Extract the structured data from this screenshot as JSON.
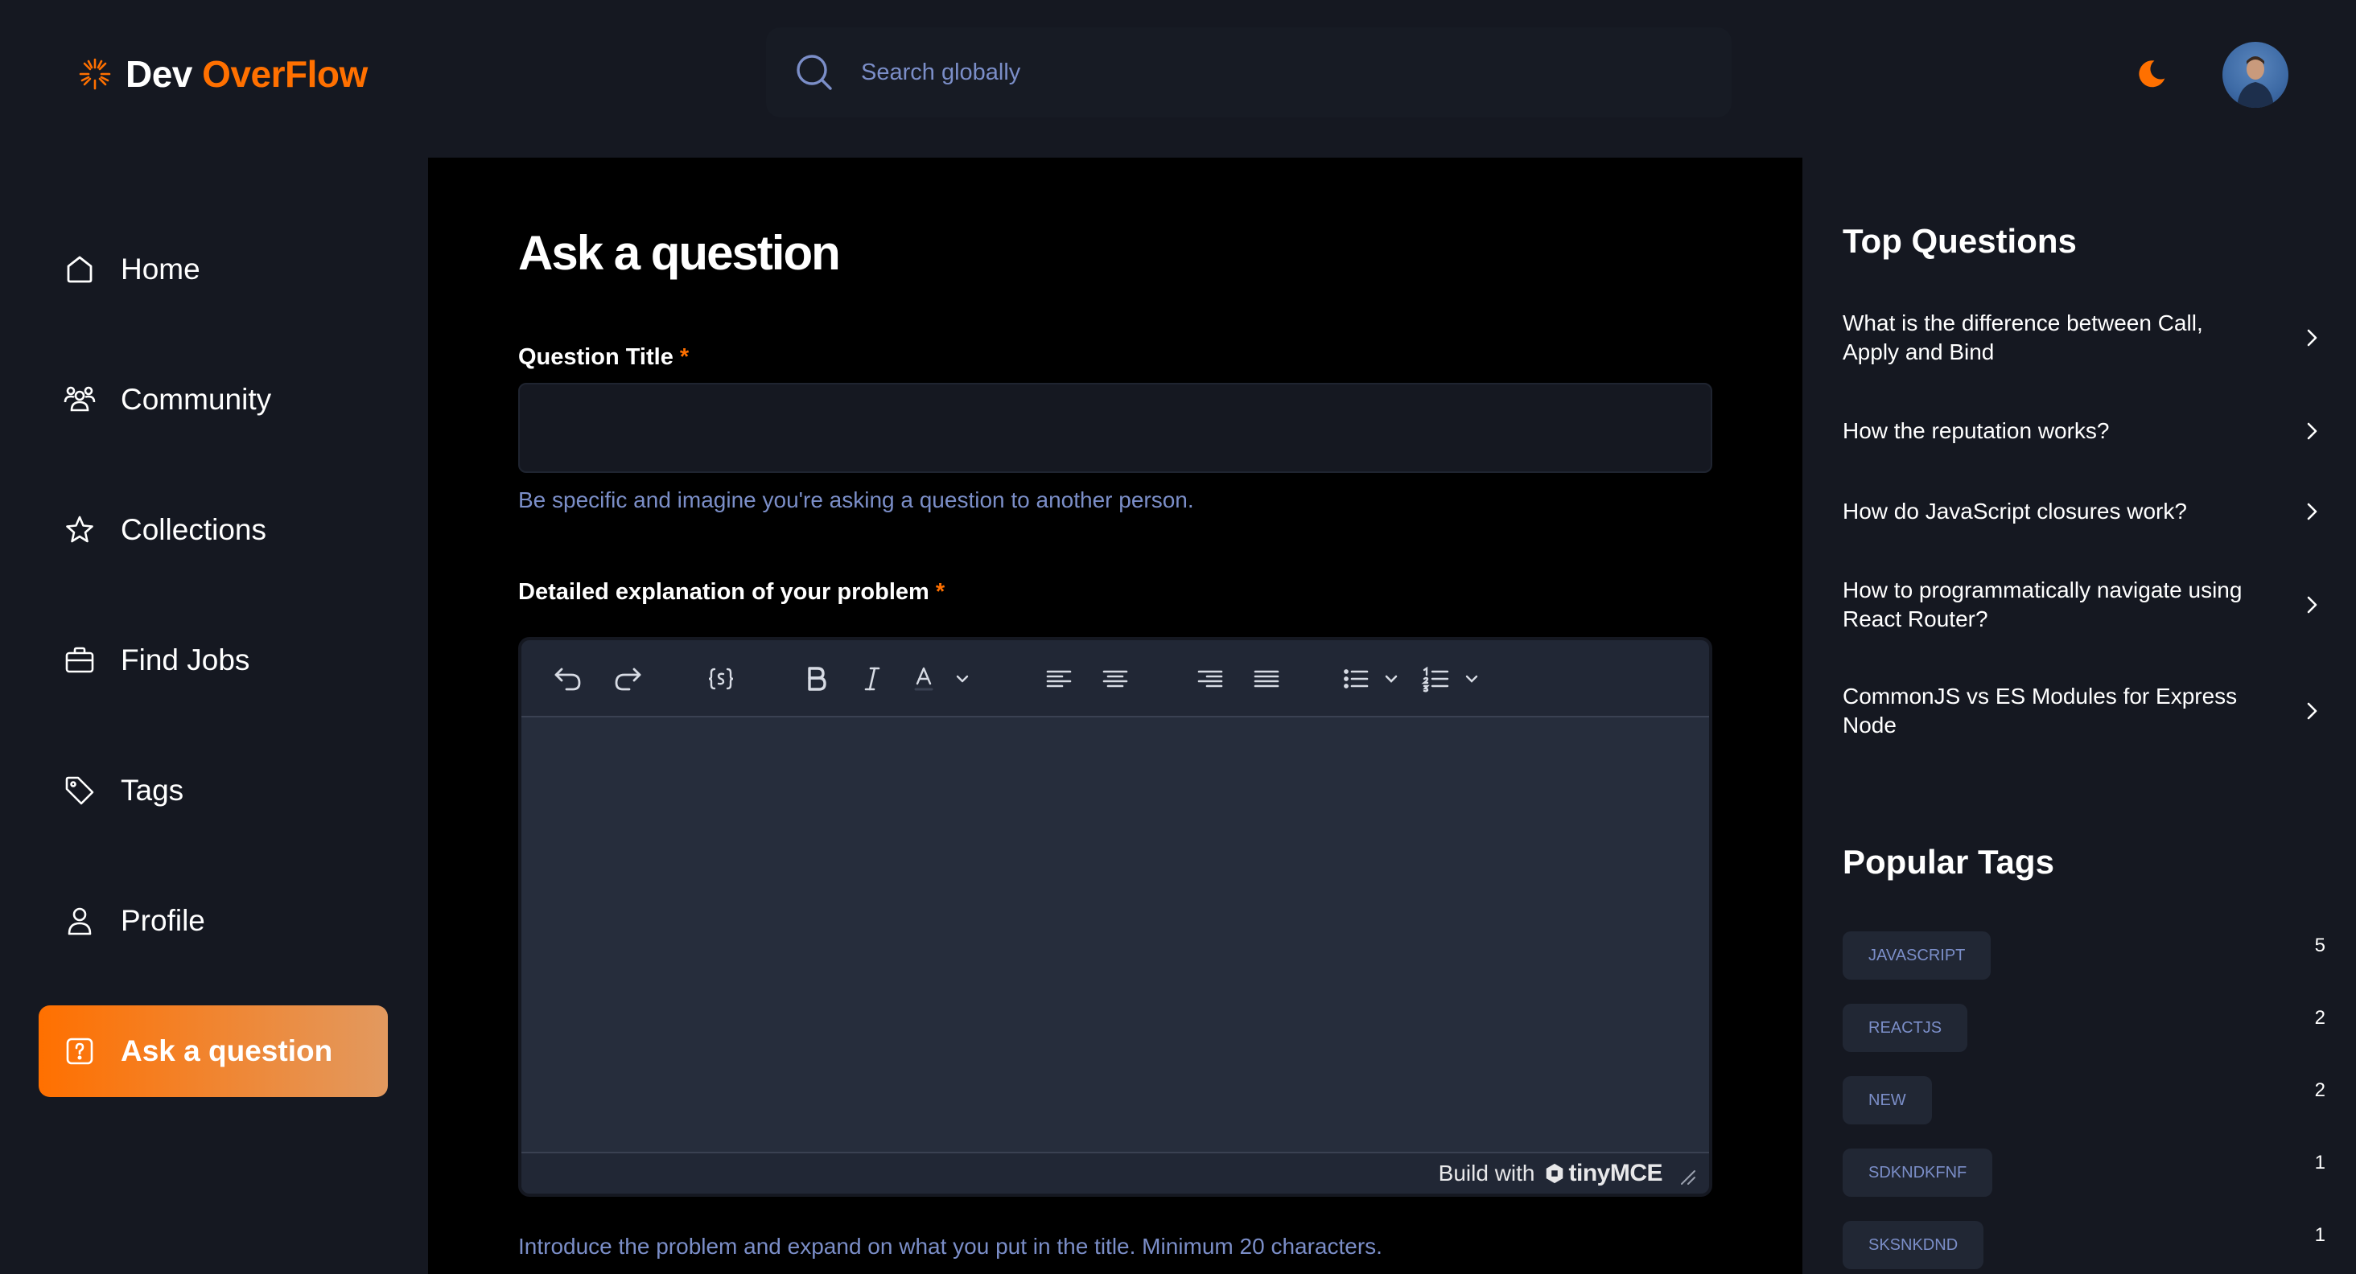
{
  "brand": {
    "name_part1": "Dev",
    "name_part2": "OverFlow",
    "accent_color": "#ff7000"
  },
  "search": {
    "placeholder": "Search globally",
    "icon": "search-icon"
  },
  "header": {
    "theme_icon": "moon-icon",
    "avatar": "user-avatar"
  },
  "sidebar": {
    "items": [
      {
        "label": "Home",
        "icon": "home-icon",
        "active": false
      },
      {
        "label": "Community",
        "icon": "users-icon",
        "active": false
      },
      {
        "label": "Collections",
        "icon": "star-icon",
        "active": false
      },
      {
        "label": "Find Jobs",
        "icon": "briefcase-icon",
        "active": false
      },
      {
        "label": "Tags",
        "icon": "tag-icon",
        "active": false
      },
      {
        "label": "Profile",
        "icon": "user-icon",
        "active": false
      },
      {
        "label": "Ask a question",
        "icon": "question-icon",
        "active": true
      }
    ]
  },
  "main": {
    "title": "Ask a question",
    "question_title": {
      "label": "Question Title",
      "required_mark": "*",
      "value": "",
      "hint": "Be specific and imagine you're asking a question to another person."
    },
    "explanation": {
      "label": "Detailed explanation of your problem",
      "required_mark": "*",
      "hint": "Introduce the problem and expand on what you put in the title. Minimum 20 characters."
    },
    "editor": {
      "toolbar": [
        "undo-icon",
        "redo-icon",
        "code-sample-icon",
        "bold-icon",
        "italic-icon",
        "text-color-icon",
        "align-left-icon",
        "align-center-icon",
        "align-right-icon",
        "align-justify-icon",
        "bullet-list-icon",
        "numbered-list-icon"
      ],
      "footer_text": "Build with",
      "brand": "tinyMCE"
    }
  },
  "right_sidebar": {
    "top_questions_title": "Top Questions",
    "top_questions": [
      "What is the difference between Call, Apply and Bind",
      "How the reputation works?",
      "How do JavaScript closures work?",
      "How to programmatically navigate using React Router?",
      "CommonJS vs ES Modules for Express Node"
    ],
    "popular_tags_title": "Popular Tags",
    "popular_tags": [
      {
        "name": "JAVASCRIPT",
        "count": "5"
      },
      {
        "name": "REACTJS",
        "count": "2"
      },
      {
        "name": "NEW",
        "count": "2"
      },
      {
        "name": "SDKNDKFNF",
        "count": "1"
      },
      {
        "name": "SKSNKDND",
        "count": "1"
      }
    ]
  }
}
